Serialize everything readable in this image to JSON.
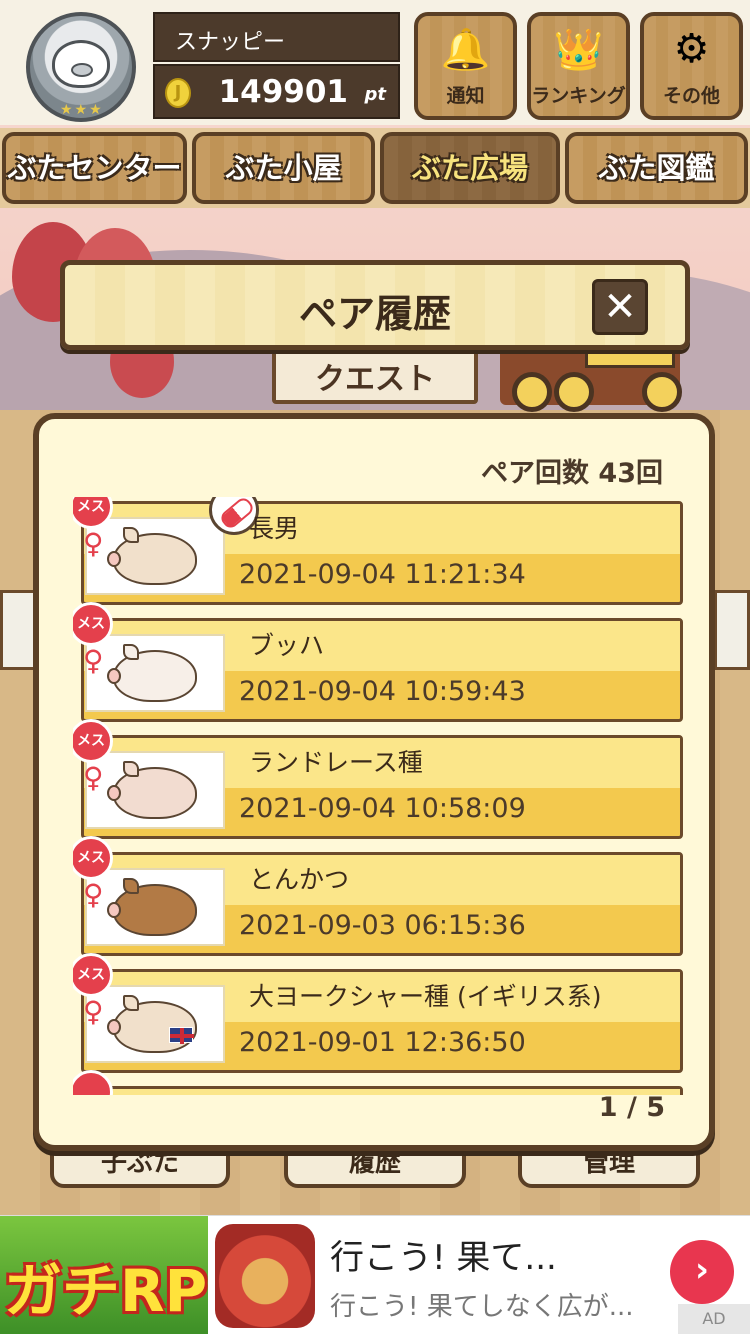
{
  "header": {
    "username": "スナッピー",
    "coin_symbol": "J",
    "points": "149901",
    "points_unit": "pt",
    "rank_stars": "★★★",
    "buttons": [
      {
        "label": "通知",
        "icon": "bell-icon",
        "glyph": "🔔"
      },
      {
        "label": "ランキング",
        "icon": "crown-icon",
        "glyph": "👑"
      },
      {
        "label": "その他",
        "icon": "gear-icon",
        "glyph": "⚙"
      }
    ]
  },
  "nav": {
    "tabs": [
      {
        "label": "ぶたセンター",
        "active": false
      },
      {
        "label": "ぶた小屋",
        "active": false
      },
      {
        "label": "ぶた広場",
        "active": true
      },
      {
        "label": "ぶた図鑑",
        "active": false
      }
    ]
  },
  "scene": {
    "sign_text": "クエスト"
  },
  "bottom_buttons": [
    "子ぶた",
    "履歴",
    "管理"
  ],
  "modal": {
    "title": "ペア履歴",
    "close_glyph": "✕",
    "pair_count": "ペア回数 43回",
    "badge_text": "メス",
    "female_symbol": "♀",
    "rows": [
      {
        "name": "長男",
        "date": "2021-09-04 11:21:34",
        "has_pill": true
      },
      {
        "name": "ブッハ",
        "date": "2021-09-04 10:59:43",
        "has_pill": false
      },
      {
        "name": "ランドレース種",
        "date": "2021-09-04 10:58:09",
        "has_pill": false
      },
      {
        "name": "とんかつ",
        "date": "2021-09-03 06:15:36",
        "has_pill": false
      },
      {
        "name": "大ヨークシャー種 (イギリス系)",
        "date": "2021-09-01 12:36:50",
        "has_pill": false
      }
    ],
    "page_indicator": "1 / 5"
  },
  "ad": {
    "image_text": "ガチRP",
    "title": "行こう! 果て...",
    "subtitle": "行こう! 果てしなく広が...",
    "arrow_glyph": "›",
    "tag": "AD"
  },
  "colors": {
    "accent": "#f3c94e",
    "female_badge": "#e4404c",
    "wood_dark": "#5a3f25"
  }
}
